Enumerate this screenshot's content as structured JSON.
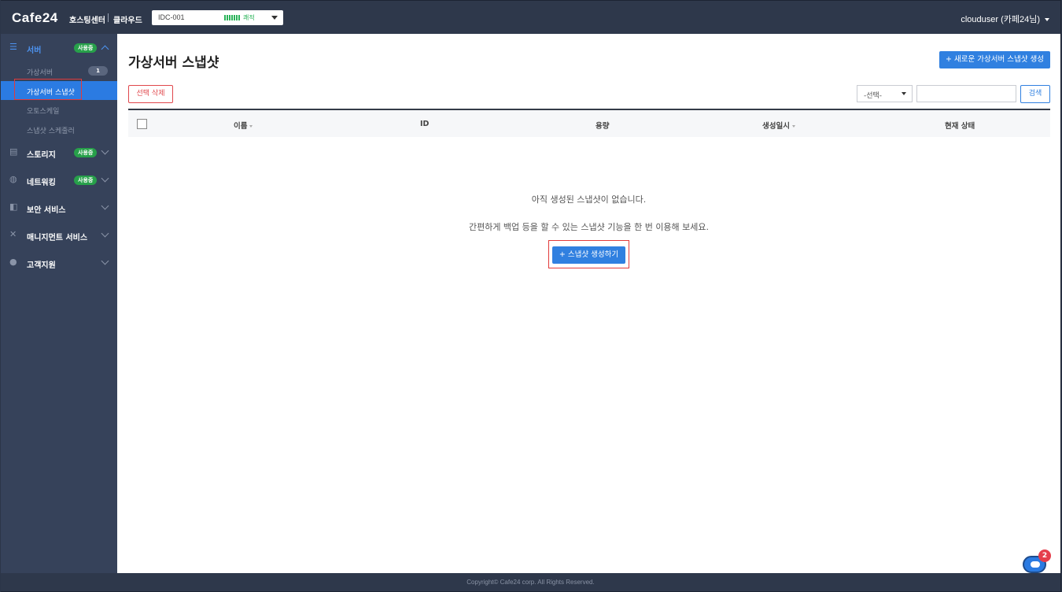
{
  "header": {
    "logo": "Cafe24",
    "logo_sub": "호스팅센터",
    "logo_sub2": "클라우드",
    "idc_name": "IDC-001",
    "idc_status": "쾌적",
    "user": "clouduser (카페24님)"
  },
  "sidebar": {
    "server": {
      "label": "서버",
      "badge": "사용중"
    },
    "server_items": [
      {
        "label": "가상서버",
        "count": "1"
      },
      {
        "label": "가상서버 스냅샷"
      },
      {
        "label": "오토스케일"
      },
      {
        "label": "스냅샷 스케줄러"
      }
    ],
    "storage": {
      "label": "스토리지",
      "badge": "사용중"
    },
    "network": {
      "label": "네트워킹",
      "badge": "사용중"
    },
    "security": {
      "label": "보안 서비스"
    },
    "management": {
      "label": "매니지먼트 서비스"
    },
    "support": {
      "label": "고객지원"
    }
  },
  "main": {
    "title": "가상서버 스냅샷",
    "new_button": "+ 새로운 가상서버 스냅샷 생성",
    "delete_button": "선택 삭제",
    "select_value": "-선택-",
    "search_placeholder": "",
    "search_button": "검색",
    "columns": [
      "이름",
      "ID",
      "용량",
      "생성일시",
      "현재 상태"
    ],
    "empty_msg1": "아직 생성된 스냅샷이 없습니다.",
    "empty_msg2": "간편하게 백업 등을 할 수 있는 스냅샷 기능을 한 번 이용해 보세요.",
    "create_button": "+ 스냅샷 생성하기"
  },
  "footer": {
    "copyright": "Copyright© Cafe24 corp. All Rights Reserved."
  },
  "chat": {
    "badge": "2"
  },
  "colors": {
    "accent": "#3080e0",
    "sidebar": "#36425a",
    "header": "#2e384b",
    "badge_green": "#27a04a",
    "highlight": "#e23a3a"
  }
}
